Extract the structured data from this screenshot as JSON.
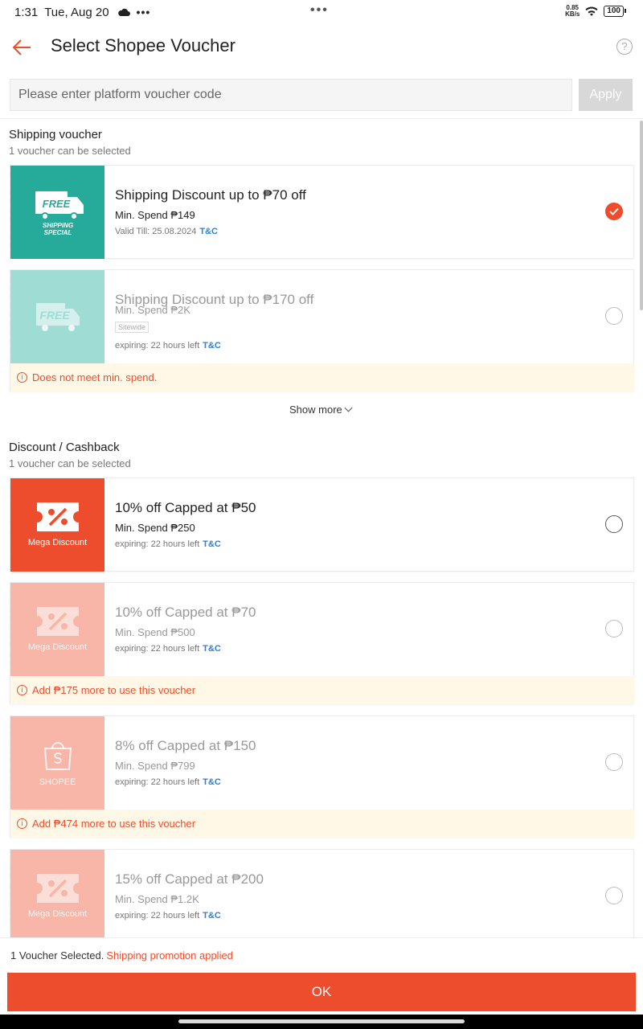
{
  "status_bar": {
    "time": "1:31",
    "date": "Tue, Aug 20",
    "dots": "•••",
    "center_dots": "•••",
    "speed_value": "0.85",
    "speed_unit": "KB/s",
    "battery": "100"
  },
  "header": {
    "title": "Select Shopee Voucher",
    "help": "?"
  },
  "search": {
    "placeholder": "Please enter platform voucher code",
    "apply_label": "Apply"
  },
  "shipping_section": {
    "title": "Shipping voucher",
    "subtitle": "1 voucher can be selected",
    "vouchers": [
      {
        "title": "Shipping Discount up to ₱70 off",
        "min_spend": "Min. Spend ₱149",
        "meta": "Valid Till: 25.08.2024",
        "tnc": "T&C",
        "art_free": "FREE",
        "art_shipping": "SHIPPING",
        "art_special": "SPECIAL",
        "selected": true
      },
      {
        "title": "Shipping Discount up to ₱170 off",
        "min_spend": "Min. Spend ₱2K",
        "tag": "Sitewide",
        "meta": "expiring: 22 hours left",
        "tnc": "T&C",
        "art_free": "FREE",
        "warning": "Does not meet min. spend.",
        "selected": false
      }
    ],
    "show_more": "Show more"
  },
  "discount_section": {
    "title": "Discount / Cashback",
    "subtitle": "1 voucher can be selected",
    "vouchers": [
      {
        "label": "Mega Discount",
        "title": "10% off Capped at ₱50",
        "min_spend": "Min. Spend ₱250",
        "meta": "expiring: 22 hours left",
        "tnc": "T&C"
      },
      {
        "label": "Mega Discount",
        "title": "10% off Capped at ₱70",
        "min_spend": "Min. Spend ₱500",
        "meta": "expiring: 22 hours left",
        "tnc": "T&C",
        "warning": "Add ₱175 more to use this voucher"
      },
      {
        "label": "SHOPEE",
        "title": "8% off Capped at ₱150",
        "min_spend": "Min. Spend ₱799",
        "meta": "expiring: 22 hours left",
        "tnc": "T&C",
        "warning": "Add ₱474 more to use this voucher"
      },
      {
        "label": "Mega Discount",
        "title": "15% off Capped at ₱200",
        "min_spend": "Min. Spend ₱1.2K",
        "meta": "expiring: 22 hours left",
        "tnc": "T&C"
      }
    ]
  },
  "footer": {
    "selected_text": "1 Voucher Selected.",
    "applied_text": "Shipping promotion applied",
    "ok_label": "OK"
  },
  "colors": {
    "brand": "#ee4d2d",
    "teal": "#26aa99",
    "link": "#2f7fd6",
    "warning_bg": "#fff8e6"
  },
  "icons": [
    "back-arrow-icon",
    "help-icon",
    "check-icon",
    "free-shipping-truck-icon",
    "percent-ticket-icon",
    "shopee-bag-icon",
    "warning-icon",
    "chevron-down-icon",
    "cloud-icon",
    "wifi-icon",
    "battery-icon"
  ]
}
